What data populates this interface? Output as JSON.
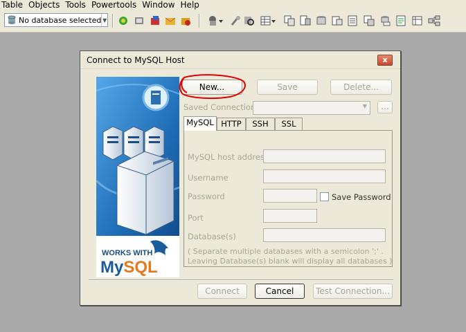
{
  "menu": [
    "Table",
    "Objects",
    "Tools",
    "Powertools",
    "Window",
    "Help"
  ],
  "toolbar": {
    "db_select_value": "No database selected",
    "icons": [
      "connect-icon",
      "disconnect-icon",
      "new-query-icon",
      "open-icon",
      "save-icon",
      "favorite-icon",
      "schema-icon",
      "wrench-icon",
      "search-icon",
      "table-icon",
      "copy-icon",
      "export-icon",
      "import-icon",
      "sync-icon",
      "backup-icon",
      "restore-icon",
      "schedule-icon",
      "report-icon",
      "designer-icon"
    ]
  },
  "dialog": {
    "title": "Connect to MySQL Host",
    "close_label": "x",
    "buttons": {
      "new": "New...",
      "save": "Save",
      "delete": "Delete..."
    },
    "saved_connections_label": "Saved Connections",
    "saved_connections_value": "",
    "browse_label": "...",
    "tabs": [
      "MySQL",
      "HTTP",
      "SSH",
      "SSL"
    ],
    "active_tab": "MySQL",
    "fields": {
      "host_label": "MySQL host address",
      "host_value": "",
      "username_label": "Username",
      "username_value": "",
      "password_label": "Password",
      "password_value": "",
      "save_password_label": "Save Password",
      "port_label": "Port",
      "port_value": "",
      "databases_label": "Database(s)",
      "databases_value": ""
    },
    "hint_line1": "( Separate multiple databases with a semicolon ';' .",
    "hint_line2": "Leaving Database(s) blank will display all databases )",
    "footer": {
      "connect": "Connect",
      "cancel": "Cancel",
      "test": "Test Connection..."
    },
    "logo": {
      "works_with": "WORKS WITH",
      "brand": "MySQL"
    }
  },
  "colors": {
    "window_bg": "#ece9d8",
    "desktop": "#a9a9a9",
    "annotation": "#e00000",
    "panel_blue": "#1e6fb5"
  }
}
